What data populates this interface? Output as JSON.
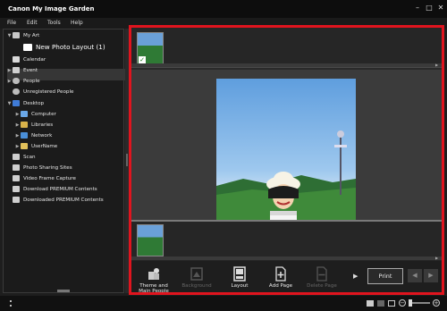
{
  "window": {
    "title": "Canon My Image Garden"
  },
  "menu": [
    "File",
    "Edit",
    "Tools",
    "Help"
  ],
  "sidebar": {
    "items": [
      {
        "label": "My Art",
        "icon": "my-art-icon"
      },
      {
        "label": "New Photo Layout (1)",
        "icon": "photo-layout-icon"
      },
      {
        "label": "Calendar",
        "icon": "calendar-icon"
      },
      {
        "label": "Event",
        "icon": "event-icon"
      },
      {
        "label": "People",
        "icon": "people-icon"
      },
      {
        "label": "Unregistered People",
        "icon": "unregistered-people-icon"
      },
      {
        "label": "Desktop",
        "icon": "desktop-icon"
      },
      {
        "label": "Computer",
        "icon": "computer-icon"
      },
      {
        "label": "Libraries",
        "icon": "libraries-icon"
      },
      {
        "label": "Network",
        "icon": "network-icon"
      },
      {
        "label": "UserName",
        "icon": "user-folder-icon"
      },
      {
        "label": "Scan",
        "icon": "scan-icon"
      },
      {
        "label": "Photo Sharing Sites",
        "icon": "photo-sharing-icon"
      },
      {
        "label": "Video Frame Capture",
        "icon": "video-frame-icon"
      },
      {
        "label": "Download PREMIUM Contents",
        "icon": "download-premium-icon"
      },
      {
        "label": "Downloaded PREMIUM Contents",
        "icon": "downloaded-premium-icon"
      }
    ]
  },
  "toolbar": {
    "theme": "Theme and Main People",
    "background": "Background",
    "layout": "Layout",
    "add_page": "Add Page",
    "delete_page": "Delete Page",
    "print": "Print"
  },
  "colors": {
    "highlight_border": "#e0141e",
    "background": "#1e1e1e"
  }
}
